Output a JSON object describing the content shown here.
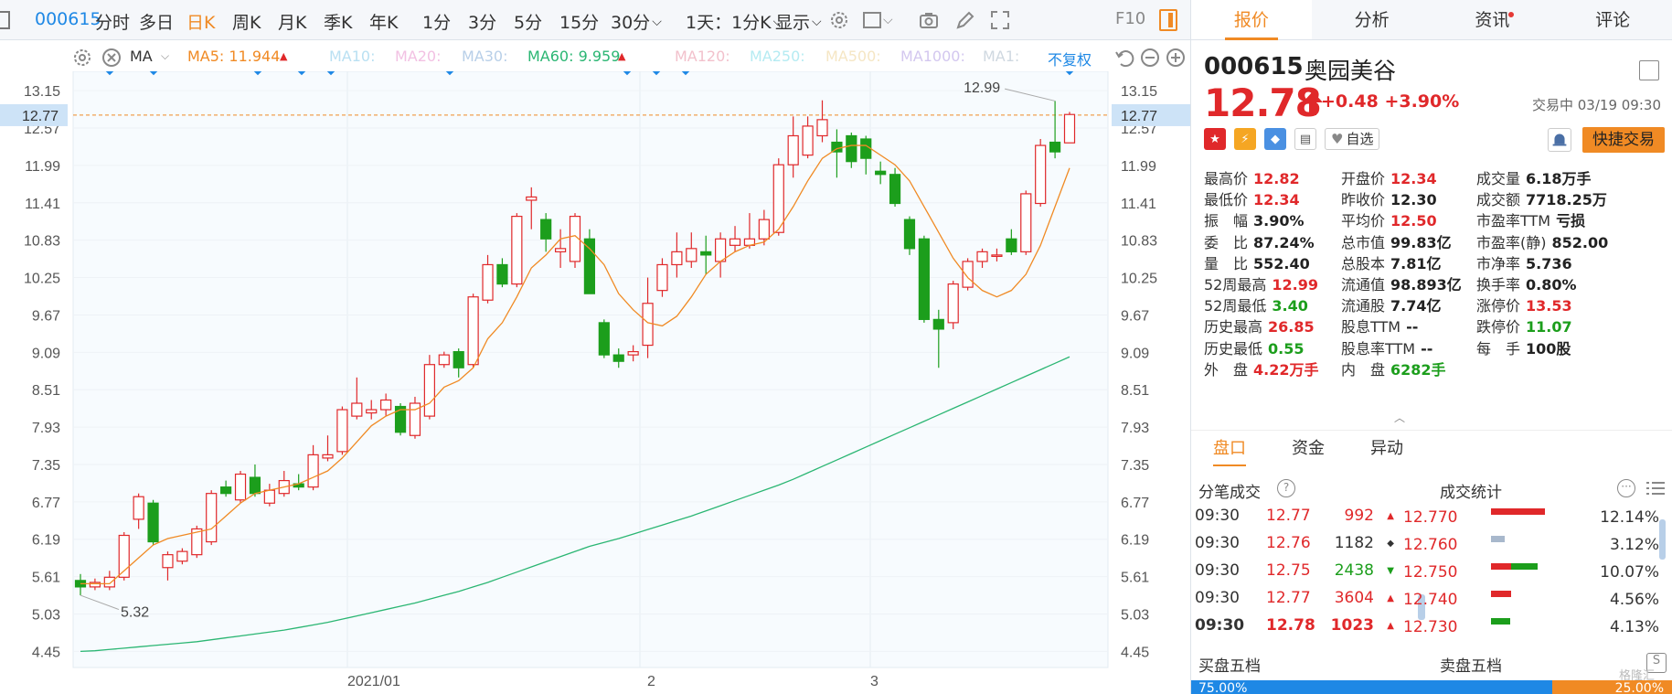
{
  "toolbar": {
    "code": "000615",
    "items": [
      "分时",
      "多日",
      "日K",
      "周K",
      "月K",
      "季K",
      "年K",
      "1分",
      "3分",
      "5分",
      "15分",
      "30分"
    ],
    "active": "日K",
    "period_select": "1天：1分K",
    "display": "显示",
    "f10": "F10"
  },
  "ma": {
    "label": "MA",
    "ma5": "MA5: 11.944",
    "ma10": "MA10:",
    "ma20": "MA20:",
    "ma30": "MA30:",
    "ma60": "MA60: 9.959",
    "ma120": "MA120:",
    "ma250": "MA250:",
    "ma500": "MA500:",
    "ma1000": "MA1000:",
    "ma1": "MA1:",
    "restore": "不复权"
  },
  "colors": {
    "up": "#e0282a",
    "down": "#1c9e1c",
    "accent": "#f08a24",
    "blue": "#1e88e5",
    "ma5": "#f08a24",
    "ma60": "#2bb673"
  },
  "chart_data": {
    "type": "candlestick",
    "y_ticks": [
      "13.15",
      "12.77",
      "12.57",
      "11.99",
      "11.41",
      "10.83",
      "10.25",
      "9.67",
      "9.09",
      "8.51",
      "7.93",
      "7.35",
      "6.77",
      "6.19",
      "5.61",
      "5.03",
      "4.45"
    ],
    "x_labels": [
      "2021/01",
      "2",
      "3"
    ],
    "current_price_label": "12.77",
    "high_annotation": "12.99",
    "low_annotation": "5.32",
    "ylim": [
      4.2,
      13.45
    ],
    "candles": [
      {
        "o": 5.55,
        "c": 5.45,
        "h": 5.65,
        "l": 5.32
      },
      {
        "o": 5.45,
        "c": 5.52,
        "h": 5.58,
        "l": 5.4
      },
      {
        "o": 5.45,
        "c": 5.6,
        "h": 5.7,
        "l": 5.4
      },
      {
        "o": 5.6,
        "c": 6.25,
        "h": 6.3,
        "l": 5.55
      },
      {
        "o": 6.5,
        "c": 6.85,
        "h": 6.9,
        "l": 6.35
      },
      {
        "o": 6.75,
        "c": 6.15,
        "h": 6.8,
        "l": 6.1
      },
      {
        "o": 5.75,
        "c": 5.95,
        "h": 6.0,
        "l": 5.55
      },
      {
        "o": 5.85,
        "c": 6.0,
        "h": 6.05,
        "l": 5.8
      },
      {
        "o": 5.95,
        "c": 6.35,
        "h": 6.4,
        "l": 5.9
      },
      {
        "o": 6.15,
        "c": 6.9,
        "h": 6.95,
        "l": 6.1
      },
      {
        "o": 7.0,
        "c": 6.9,
        "h": 7.1,
        "l": 6.85
      },
      {
        "o": 6.8,
        "c": 7.2,
        "h": 7.25,
        "l": 6.75
      },
      {
        "o": 7.15,
        "c": 6.9,
        "h": 7.35,
        "l": 6.85
      },
      {
        "o": 6.75,
        "c": 6.95,
        "h": 7.05,
        "l": 6.7
      },
      {
        "o": 6.9,
        "c": 7.1,
        "h": 7.25,
        "l": 6.85
      },
      {
        "o": 7.05,
        "c": 7.0,
        "h": 7.2,
        "l": 6.95
      },
      {
        "o": 7.0,
        "c": 7.5,
        "h": 7.65,
        "l": 6.95
      },
      {
        "o": 7.45,
        "c": 7.5,
        "h": 7.8,
        "l": 7.4
      },
      {
        "o": 7.55,
        "c": 8.2,
        "h": 8.25,
        "l": 7.5
      },
      {
        "o": 8.1,
        "c": 8.3,
        "h": 8.7,
        "l": 8.05
      },
      {
        "o": 8.15,
        "c": 8.2,
        "h": 8.35,
        "l": 8.05
      },
      {
        "o": 8.2,
        "c": 8.35,
        "h": 8.45,
        "l": 8.1
      },
      {
        "o": 8.25,
        "c": 7.85,
        "h": 8.3,
        "l": 7.8
      },
      {
        "o": 7.8,
        "c": 8.3,
        "h": 8.4,
        "l": 7.75
      },
      {
        "o": 8.1,
        "c": 8.9,
        "h": 9.05,
        "l": 8.05
      },
      {
        "o": 8.9,
        "c": 9.05,
        "h": 9.1,
        "l": 8.85
      },
      {
        "o": 9.1,
        "c": 8.85,
        "h": 9.15,
        "l": 8.7
      },
      {
        "o": 8.9,
        "c": 9.95,
        "h": 10.0,
        "l": 8.85
      },
      {
        "o": 9.9,
        "c": 10.45,
        "h": 10.6,
        "l": 9.85
      },
      {
        "o": 10.45,
        "c": 10.15,
        "h": 10.55,
        "l": 10.1
      },
      {
        "o": 10.15,
        "c": 11.2,
        "h": 11.25,
        "l": 10.1
      },
      {
        "o": 11.45,
        "c": 11.5,
        "h": 11.65,
        "l": 11.0
      },
      {
        "o": 11.15,
        "c": 10.85,
        "h": 11.25,
        "l": 10.65
      },
      {
        "o": 10.65,
        "c": 10.7,
        "h": 11.0,
        "l": 10.4
      },
      {
        "o": 10.5,
        "c": 11.2,
        "h": 11.25,
        "l": 10.4
      },
      {
        "o": 10.85,
        "c": 10.0,
        "h": 11.0,
        "l": 10.0
      },
      {
        "o": 9.55,
        "c": 9.05,
        "h": 9.6,
        "l": 9.0
      },
      {
        "o": 9.05,
        "c": 8.95,
        "h": 9.15,
        "l": 8.85
      },
      {
        "o": 9.05,
        "c": 9.1,
        "h": 9.2,
        "l": 8.95
      },
      {
        "o": 9.2,
        "c": 9.85,
        "h": 10.25,
        "l": 9.0
      },
      {
        "o": 10.05,
        "c": 10.45,
        "h": 10.55,
        "l": 9.95
      },
      {
        "o": 10.45,
        "c": 10.65,
        "h": 10.95,
        "l": 10.25
      },
      {
        "o": 10.5,
        "c": 10.7,
        "h": 10.95,
        "l": 10.4
      },
      {
        "o": 10.65,
        "c": 10.6,
        "h": 10.9,
        "l": 10.3
      },
      {
        "o": 10.5,
        "c": 10.85,
        "h": 10.95,
        "l": 10.25
      },
      {
        "o": 10.75,
        "c": 10.85,
        "h": 11.05,
        "l": 10.65
      },
      {
        "o": 10.75,
        "c": 10.85,
        "h": 11.25,
        "l": 10.7
      },
      {
        "o": 10.85,
        "c": 11.15,
        "h": 11.3,
        "l": 10.75
      },
      {
        "o": 10.95,
        "c": 12.0,
        "h": 12.1,
        "l": 10.9
      },
      {
        "o": 12.0,
        "c": 12.45,
        "h": 12.75,
        "l": 11.8
      },
      {
        "o": 12.15,
        "c": 12.6,
        "h": 12.75,
        "l": 12.1
      },
      {
        "o": 12.45,
        "c": 12.7,
        "h": 13.0,
        "l": 12.35
      },
      {
        "o": 12.35,
        "c": 12.2,
        "h": 12.55,
        "l": 11.8
      },
      {
        "o": 12.45,
        "c": 12.05,
        "h": 12.5,
        "l": 11.95
      },
      {
        "o": 12.4,
        "c": 12.1,
        "h": 12.45,
        "l": 11.85
      },
      {
        "o": 11.9,
        "c": 11.85,
        "h": 12.05,
        "l": 11.7
      },
      {
        "o": 11.85,
        "c": 11.4,
        "h": 11.95,
        "l": 11.35
      },
      {
        "o": 11.15,
        "c": 10.7,
        "h": 11.2,
        "l": 10.6
      },
      {
        "o": 10.85,
        "c": 9.6,
        "h": 10.9,
        "l": 9.55
      },
      {
        "o": 9.6,
        "c": 9.45,
        "h": 9.75,
        "l": 8.85
      },
      {
        "o": 9.55,
        "c": 10.15,
        "h": 10.2,
        "l": 9.45
      },
      {
        "o": 10.1,
        "c": 10.5,
        "h": 10.55,
        "l": 10.05
      },
      {
        "o": 10.5,
        "c": 10.65,
        "h": 10.7,
        "l": 10.4
      },
      {
        "o": 10.6,
        "c": 10.6,
        "h": 10.7,
        "l": 10.5
      },
      {
        "o": 10.85,
        "c": 10.65,
        "h": 11.0,
        "l": 10.6
      },
      {
        "o": 10.65,
        "c": 11.55,
        "h": 11.6,
        "l": 10.6
      },
      {
        "o": 11.4,
        "c": 12.3,
        "h": 12.4,
        "l": 11.35
      },
      {
        "o": 12.35,
        "c": 12.2,
        "h": 12.99,
        "l": 12.1
      },
      {
        "o": 12.34,
        "c": 12.78,
        "h": 12.82,
        "l": 12.34
      }
    ],
    "series": [
      {
        "name": "MA5",
        "values": [
          5.5,
          5.5,
          5.5,
          5.7,
          5.9,
          6.1,
          6.2,
          6.25,
          6.3,
          6.35,
          6.55,
          6.75,
          6.9,
          6.95,
          7.0,
          7.05,
          7.15,
          7.25,
          7.45,
          7.7,
          7.95,
          8.1,
          8.2,
          8.2,
          8.3,
          8.55,
          8.65,
          8.85,
          9.3,
          9.55,
          9.95,
          10.4,
          10.6,
          10.85,
          10.9,
          10.7,
          10.45,
          10.0,
          9.75,
          9.55,
          9.5,
          9.65,
          9.95,
          10.3,
          10.5,
          10.65,
          10.75,
          10.8,
          11.0,
          11.35,
          11.75,
          12.1,
          12.25,
          12.3,
          12.3,
          12.15,
          12.0,
          11.75,
          11.35,
          10.95,
          10.55,
          10.25,
          10.05,
          9.95,
          10.05,
          10.3,
          10.75,
          11.35,
          11.95
        ]
      },
      {
        "name": "MA60",
        "values": [
          4.45,
          4.46,
          4.48,
          4.5,
          4.52,
          4.54,
          4.56,
          4.58,
          4.6,
          4.63,
          4.66,
          4.69,
          4.72,
          4.75,
          4.78,
          4.82,
          4.86,
          4.9,
          4.95,
          5.0,
          5.05,
          5.1,
          5.15,
          5.2,
          5.26,
          5.32,
          5.38,
          5.45,
          5.52,
          5.6,
          5.68,
          5.76,
          5.84,
          5.92,
          6.0,
          6.08,
          6.14,
          6.2,
          6.27,
          6.34,
          6.41,
          6.48,
          6.55,
          6.63,
          6.71,
          6.79,
          6.87,
          6.95,
          7.03,
          7.12,
          7.22,
          7.32,
          7.42,
          7.52,
          7.62,
          7.72,
          7.82,
          7.92,
          8.02,
          8.12,
          8.22,
          8.32,
          8.42,
          8.52,
          8.62,
          8.72,
          8.82,
          8.92,
          9.02
        ]
      }
    ]
  },
  "stock": {
    "code": "000615",
    "name": "奥园美谷",
    "price": "12.78",
    "change": "+0.48",
    "pct": "+3.90%",
    "status": "交易中 03/19 09:30",
    "watch": "自选",
    "fast_trade": "快捷交易"
  },
  "tabs": [
    "报价",
    "分析",
    "资讯",
    "评论"
  ],
  "quote": [
    [
      "最高价",
      "12.82",
      "red"
    ],
    [
      "开盘价",
      "12.34",
      "red"
    ],
    [
      "成交量",
      "6.18万手",
      "dark"
    ],
    [
      "最低价",
      "12.34",
      "red"
    ],
    [
      "昨收价",
      "12.30",
      "dark"
    ],
    [
      "成交额",
      "7718.25万",
      "dark"
    ],
    [
      "振　幅",
      "3.90%",
      "dark"
    ],
    [
      "平均价",
      "12.50",
      "red"
    ],
    [
      "市盈率TTM",
      "亏损",
      "dark"
    ],
    [
      "委　比",
      "87.24%",
      "dark"
    ],
    [
      "总市值",
      "99.83亿",
      "dark"
    ],
    [
      "市盈率(静)",
      "852.00",
      "dark"
    ],
    [
      "量　比",
      "552.40",
      "dark"
    ],
    [
      "总股本",
      "7.81亿",
      "dark"
    ],
    [
      "市净率",
      "5.736",
      "dark"
    ],
    [
      "52周最高",
      "12.99",
      "red"
    ],
    [
      "流通值",
      "98.893亿",
      "dark"
    ],
    [
      "换手率",
      "0.80%",
      "dark"
    ],
    [
      "52周最低",
      "3.40",
      "green"
    ],
    [
      "流通股",
      "7.74亿",
      "dark"
    ],
    [
      "涨停价",
      "13.53",
      "red"
    ],
    [
      "历史最高",
      "26.85",
      "red"
    ],
    [
      "股息TTM",
      "--",
      "dark"
    ],
    [
      "跌停价",
      "11.07",
      "green"
    ],
    [
      "历史最低",
      "0.55",
      "green"
    ],
    [
      "股息率TTM",
      "--",
      "dark"
    ],
    [
      "每　手",
      "100股",
      "dark"
    ],
    [
      "外　盘",
      "4.22万手",
      "red"
    ],
    [
      "内　盘",
      "6282手",
      "green"
    ]
  ],
  "sub_tabs": [
    "盘口",
    "资金",
    "异动"
  ],
  "tick_title": "分笔成交",
  "stat_title": "成交统计",
  "ticks": [
    {
      "t": "09:30",
      "p": "12.77",
      "v": "992",
      "d": "up"
    },
    {
      "t": "09:30",
      "p": "12.76",
      "v": "1182",
      "d": "flat"
    },
    {
      "t": "09:30",
      "p": "12.75",
      "v": "2438",
      "d": "down"
    },
    {
      "t": "09:30",
      "p": "12.77",
      "v": "3604",
      "d": "up"
    },
    {
      "t": "09:30",
      "p": "12.78",
      "v": "1023",
      "d": "up"
    }
  ],
  "stats": [
    {
      "p": "12.770",
      "pct": "12.14%",
      "r": 0.92,
      "g": 0.0,
      "gray": 0.0
    },
    {
      "p": "12.760",
      "pct": "3.12%",
      "r": 0.0,
      "g": 0.0,
      "gray": 0.23
    },
    {
      "p": "12.750",
      "pct": "10.07%",
      "r": 0.35,
      "g": 0.45,
      "gray": 0.0
    },
    {
      "p": "12.740",
      "pct": "4.56%",
      "r": 0.35,
      "g": 0.0,
      "gray": 0.0
    },
    {
      "p": "12.730",
      "pct": "4.13%",
      "r": 0.0,
      "g": 0.33,
      "gray": 0.0
    }
  ],
  "buy5": "买盘五档",
  "sell5": "卖盘五档",
  "buy_ratio": "75.00%",
  "sell_ratio": "25.00%",
  "buy_frac": 0.75,
  "watermark": "格隆汇"
}
